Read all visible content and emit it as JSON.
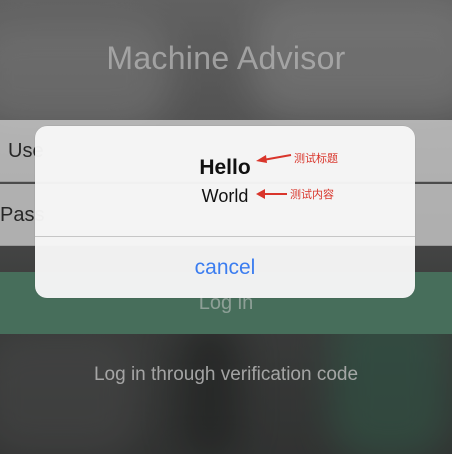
{
  "app": {
    "title": "Machine Advisor"
  },
  "login_form": {
    "username_label": "Use",
    "password_label": "Pass",
    "login_button_label": "Log in",
    "verification_link": "Log in through verification code"
  },
  "alert": {
    "title": "Hello",
    "message": "World",
    "cancel_label": "cancel"
  },
  "annotations": {
    "title_note": "测试标题",
    "message_note": "测试内容"
  },
  "colors": {
    "accent_blue": "#3b7df0",
    "login_green": "#5b8e75",
    "annotation_red": "#d9352b"
  }
}
